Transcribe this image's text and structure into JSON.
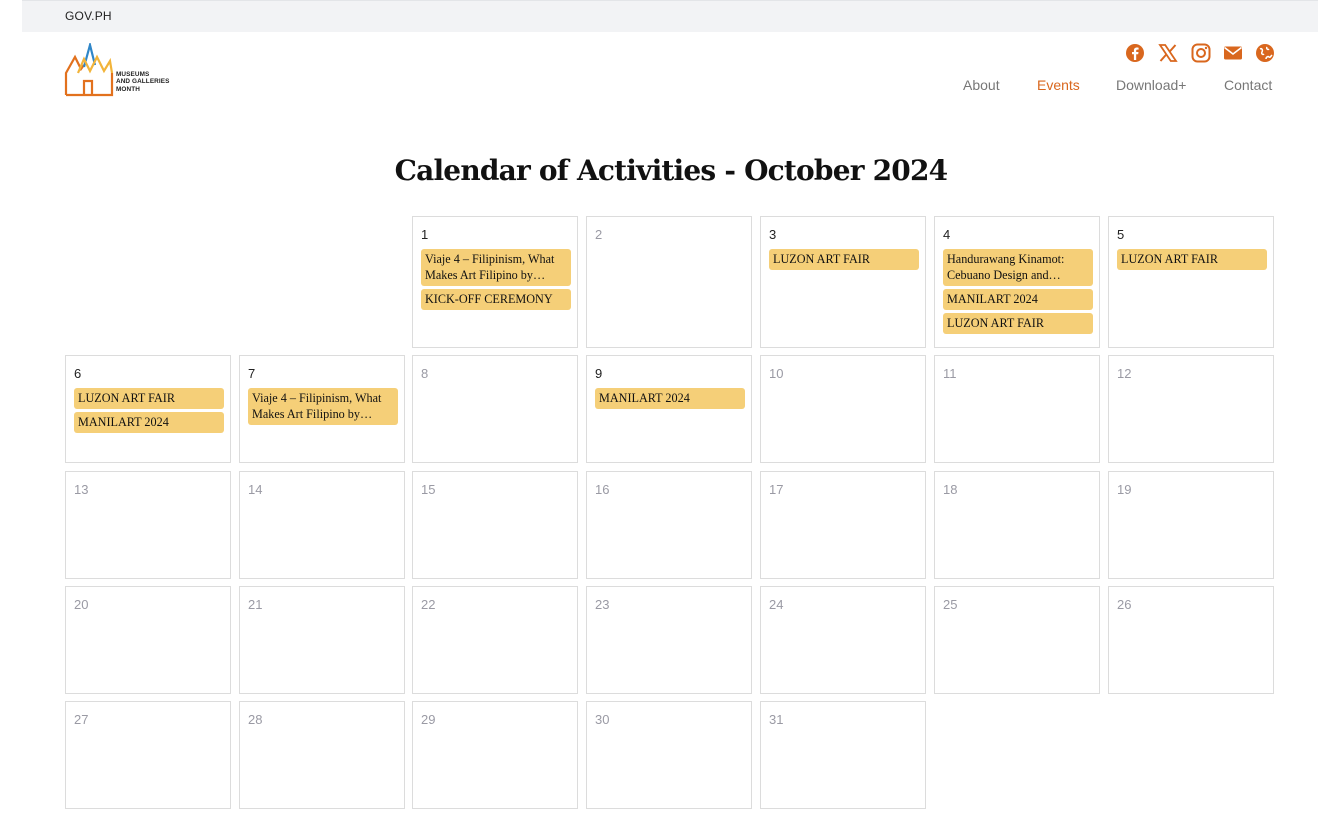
{
  "govbar": {
    "label": "GOV.PH"
  },
  "logo": {
    "text_lines": [
      "MUSEUMS",
      "AND GALLERIES",
      "MONTH"
    ],
    "colors": {
      "orange": "#e2711d",
      "blue": "#2f86c8",
      "yellow": "#f2b43a"
    }
  },
  "social": [
    "facebook-icon",
    "x-twitter-icon",
    "instagram-icon",
    "mail-icon",
    "globe-icon"
  ],
  "accent_color": "#d9671e",
  "nav": {
    "items": [
      {
        "label": "About",
        "active": false
      },
      {
        "label": "Events",
        "active": true
      },
      {
        "label": "Download+",
        "active": false
      },
      {
        "label": "Contact",
        "active": false
      }
    ]
  },
  "page": {
    "title": "Calendar of Activities - October 2024"
  },
  "event_color": "#f5cf78",
  "calendar": {
    "weeks": [
      [
        null,
        null,
        {
          "day": "1",
          "events": [
            "Viaje 4 – Filipinism, What Makes Art Filipino by…",
            "KICK-OFF CEREMONY"
          ]
        },
        {
          "day": "2",
          "events": []
        },
        {
          "day": "3",
          "events": [
            "LUZON ART FAIR"
          ]
        },
        {
          "day": "4",
          "events": [
            "Handurawang Kinamot: Cebuano Design and…",
            "MANILART 2024",
            "LUZON ART FAIR"
          ]
        },
        {
          "day": "5",
          "events": [
            "LUZON ART FAIR"
          ]
        }
      ],
      [
        {
          "day": "6",
          "events": [
            "LUZON ART FAIR",
            "MANILART 2024"
          ]
        },
        {
          "day": "7",
          "events": [
            "Viaje 4 – Filipinism, What Makes Art Filipino by…"
          ]
        },
        {
          "day": "8",
          "events": []
        },
        {
          "day": "9",
          "events": [
            "MANILART 2024"
          ]
        },
        {
          "day": "10",
          "events": []
        },
        {
          "day": "11",
          "events": []
        },
        {
          "day": "12",
          "events": []
        }
      ],
      [
        {
          "day": "13",
          "events": []
        },
        {
          "day": "14",
          "events": []
        },
        {
          "day": "15",
          "events": []
        },
        {
          "day": "16",
          "events": []
        },
        {
          "day": "17",
          "events": []
        },
        {
          "day": "18",
          "events": []
        },
        {
          "day": "19",
          "events": []
        }
      ],
      [
        {
          "day": "20",
          "events": []
        },
        {
          "day": "21",
          "events": []
        },
        {
          "day": "22",
          "events": []
        },
        {
          "day": "23",
          "events": []
        },
        {
          "day": "24",
          "events": []
        },
        {
          "day": "25",
          "events": []
        },
        {
          "day": "26",
          "events": []
        }
      ],
      [
        {
          "day": "27",
          "events": []
        },
        {
          "day": "28",
          "events": []
        },
        {
          "day": "29",
          "events": []
        },
        {
          "day": "30",
          "events": []
        },
        {
          "day": "31",
          "events": []
        },
        null,
        null
      ]
    ]
  }
}
